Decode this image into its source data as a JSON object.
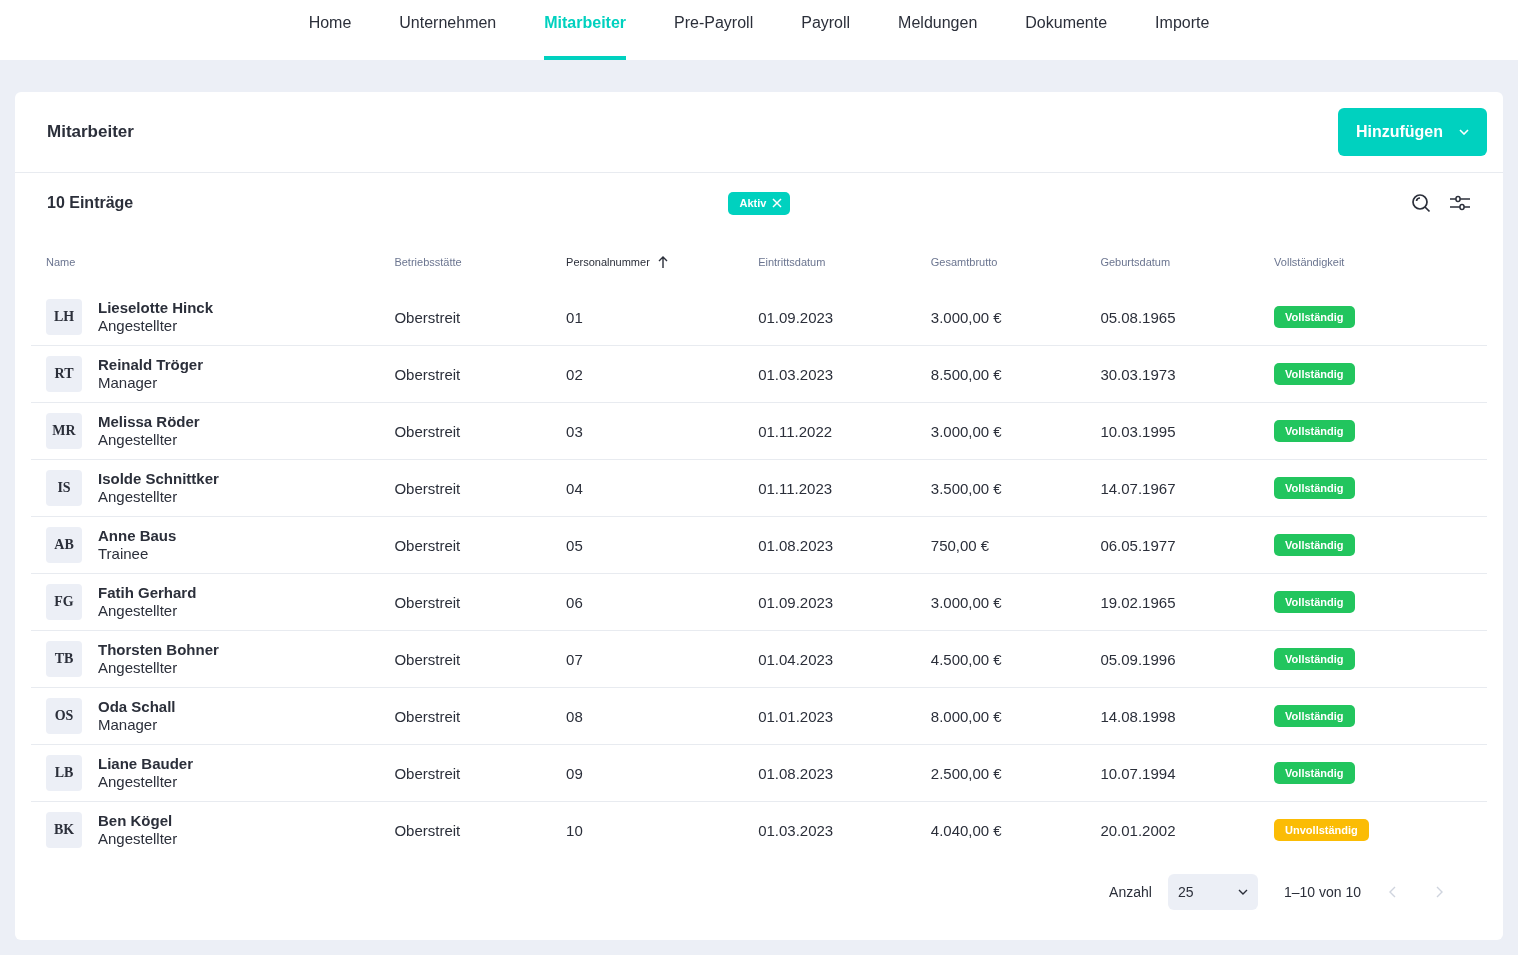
{
  "nav": [
    {
      "label": "Home",
      "selected": false
    },
    {
      "label": "Unternehmen",
      "selected": false
    },
    {
      "label": "Mitarbeiter",
      "selected": true
    },
    {
      "label": "Pre-Payroll",
      "selected": false
    },
    {
      "label": "Payroll",
      "selected": false
    },
    {
      "label": "Meldungen",
      "selected": false
    },
    {
      "label": "Dokumente",
      "selected": false
    },
    {
      "label": "Importe",
      "selected": false
    }
  ],
  "card": {
    "title": "Mitarbeiter",
    "add_button": "Hinzufügen"
  },
  "toolbar": {
    "count": "10 Einträge",
    "filter_chip": "Aktiv"
  },
  "table": {
    "columns": [
      {
        "label": "Name",
        "sorted": false
      },
      {
        "label": "Betriebsstätte",
        "sorted": false
      },
      {
        "label": "Personalnummer",
        "sorted": true
      },
      {
        "label": "Eintrittsdatum",
        "sorted": false
      },
      {
        "label": "Gesamtbrutto",
        "sorted": false
      },
      {
        "label": "Geburtsdatum",
        "sorted": false
      },
      {
        "label": "Vollständigkeit",
        "sorted": false
      }
    ],
    "rows": [
      {
        "initials": "LH",
        "name": "Lieselotte Hinck",
        "role": "Angestellter",
        "site": "Oberstreit",
        "number": "01",
        "entry": "01.09.2023",
        "gross": "3.000,00 €",
        "birth": "05.08.1965",
        "status": "Vollständig",
        "color": "#22c55e"
      },
      {
        "initials": "RT",
        "name": "Reinald Tröger",
        "role": "Manager",
        "site": "Oberstreit",
        "number": "02",
        "entry": "01.03.2023",
        "gross": "8.500,00 €",
        "birth": "30.03.1973",
        "status": "Vollständig",
        "color": "#22c55e"
      },
      {
        "initials": "MR",
        "name": "Melissa Röder",
        "role": "Angestellter",
        "site": "Oberstreit",
        "number": "03",
        "entry": "01.11.2022",
        "gross": "3.000,00 €",
        "birth": "10.03.1995",
        "status": "Vollständig",
        "color": "#22c55e"
      },
      {
        "initials": "IS",
        "name": "Isolde Schnittker",
        "role": "Angestellter",
        "site": "Oberstreit",
        "number": "04",
        "entry": "01.11.2023",
        "gross": "3.500,00 €",
        "birth": "14.07.1967",
        "status": "Vollständig",
        "color": "#22c55e"
      },
      {
        "initials": "AB",
        "name": "Anne Baus",
        "role": "Trainee",
        "site": "Oberstreit",
        "number": "05",
        "entry": "01.08.2023",
        "gross": "750,00 €",
        "birth": "06.05.1977",
        "status": "Vollständig",
        "color": "#22c55e"
      },
      {
        "initials": "FG",
        "name": "Fatih Gerhard",
        "role": "Angestellter",
        "site": "Oberstreit",
        "number": "06",
        "entry": "01.09.2023",
        "gross": "3.000,00 €",
        "birth": "19.02.1965",
        "status": "Vollständig",
        "color": "#22c55e"
      },
      {
        "initials": "TB",
        "name": "Thorsten Bohner",
        "role": "Angestellter",
        "site": "Oberstreit",
        "number": "07",
        "entry": "01.04.2023",
        "gross": "4.500,00 €",
        "birth": "05.09.1996",
        "status": "Vollständig",
        "color": "#22c55e"
      },
      {
        "initials": "OS",
        "name": "Oda Schall",
        "role": "Manager",
        "site": "Oberstreit",
        "number": "08",
        "entry": "01.01.2023",
        "gross": "8.000,00 €",
        "birth": "14.08.1998",
        "status": "Vollständig",
        "color": "#22c55e"
      },
      {
        "initials": "LB",
        "name": "Liane Bauder",
        "role": "Angestellter",
        "site": "Oberstreit",
        "number": "09",
        "entry": "01.08.2023",
        "gross": "2.500,00 €",
        "birth": "10.07.1994",
        "status": "Vollständig",
        "color": "#22c55e"
      },
      {
        "initials": "BK",
        "name": "Ben Kögel",
        "role": "Angestellter",
        "site": "Oberstreit",
        "number": "10",
        "entry": "01.03.2023",
        "gross": "4.040,00 €",
        "birth": "20.01.2002",
        "status": "Unvollständig",
        "color": "#fbbc05"
      }
    ]
  },
  "pagination": {
    "label": "Anzahl",
    "page_size": "25",
    "range": "1–10 von 10"
  }
}
